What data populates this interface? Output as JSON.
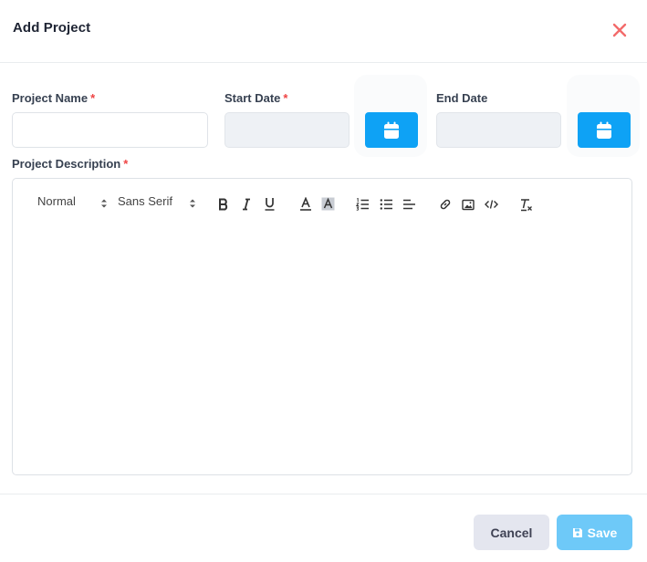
{
  "modal": {
    "title": "Add Project",
    "close_icon": "close-icon",
    "accent_color": "#0ea2f5",
    "close_color": "#f36b6b"
  },
  "fields": {
    "project_name": {
      "label": "Project Name",
      "required_mark": "*",
      "value": "",
      "placeholder": ""
    },
    "start_date": {
      "label": "Start Date",
      "required_mark": "*",
      "value": "",
      "icon": "calendar-icon"
    },
    "end_date": {
      "label": "End Date",
      "value": "",
      "icon": "calendar-icon"
    },
    "project_description": {
      "label": "Project Description",
      "required_mark": "*",
      "value": ""
    }
  },
  "editor": {
    "size_picker": "Normal",
    "font_picker": "Sans Serif",
    "tools": [
      "bold-icon",
      "italic-icon",
      "underline-icon",
      "text-color-icon",
      "background-color-icon",
      "ordered-list-icon",
      "bullet-list-icon",
      "align-icon",
      "link-icon",
      "image-icon",
      "code-icon",
      "clear-format-icon"
    ]
  },
  "footer": {
    "cancel_label": "Cancel",
    "save_label": "Save",
    "save_icon": "save-icon"
  }
}
